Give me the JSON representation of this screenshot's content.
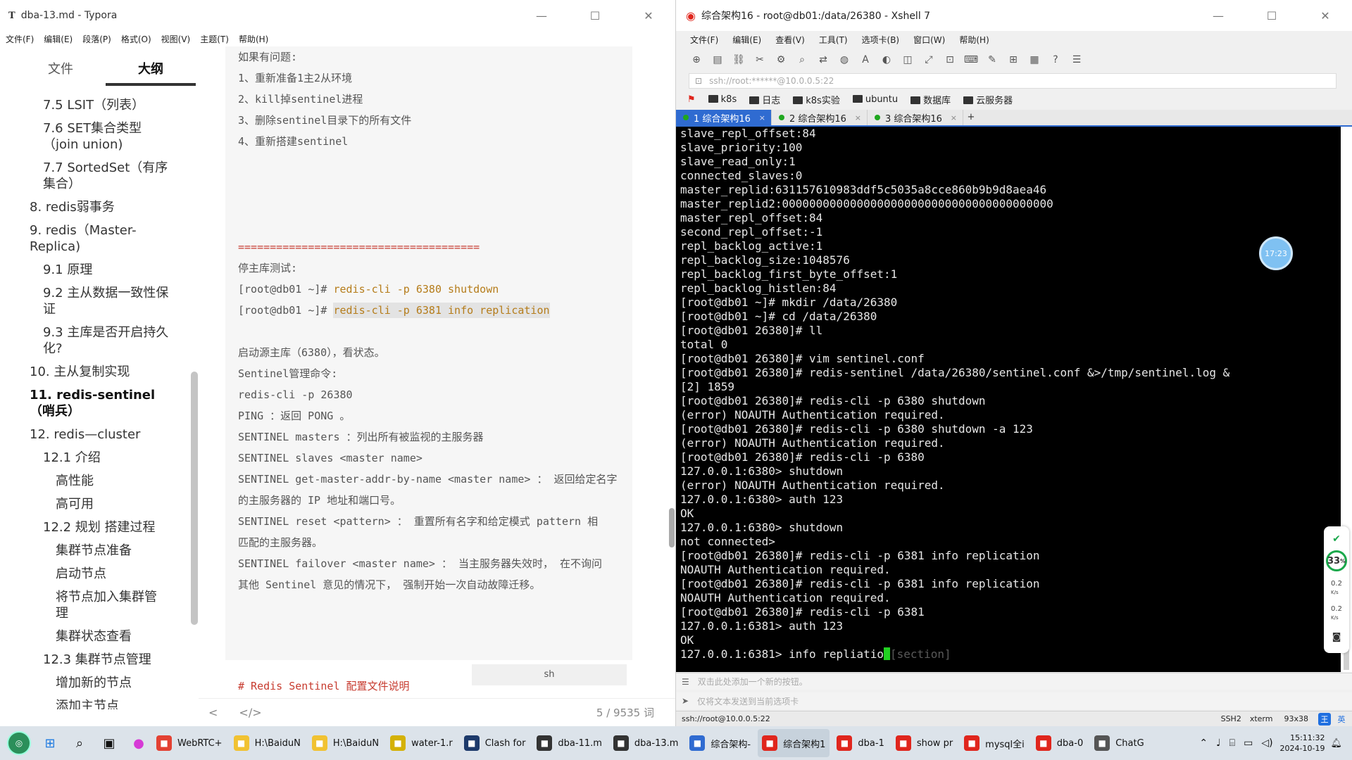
{
  "typora": {
    "title": "dba-13.md - Typora",
    "title_icon": "T",
    "controls": {
      "minimize": "—",
      "maximize": "☐",
      "close": "✕"
    },
    "menu": [
      "文件(F)",
      "编辑(E)",
      "段落(P)",
      "格式(O)",
      "视图(V)",
      "主题(T)",
      "帮助(H)"
    ],
    "sidebar_tabs": [
      "文件",
      "大纲"
    ],
    "active_tab": "大纲",
    "outline": [
      {
        "text": "7.5 LSIT（列表）",
        "level": 2
      },
      {
        "text": "7.6 SET集合类型（join union)",
        "level": 2
      },
      {
        "text": "7.7 SortedSet（有序集合）",
        "level": 2
      },
      {
        "text": "8. redis弱事务",
        "level": 1
      },
      {
        "text": "9. redis（Master-Replica)",
        "level": 1
      },
      {
        "text": "9.1 原理",
        "level": 2
      },
      {
        "text": "9.2 主从数据一致性保证",
        "level": 2
      },
      {
        "text": "9.3 主库是否开启持久化?",
        "level": 2
      },
      {
        "text": "10. 主从复制实现",
        "level": 1
      },
      {
        "text": "11. redis-sentinel（哨兵）",
        "level": 1,
        "bold": true
      },
      {
        "text": "12. redis—cluster",
        "level": 1
      },
      {
        "text": "12.1 介绍",
        "level": 2
      },
      {
        "text": "高性能",
        "level": 3
      },
      {
        "text": "高可用",
        "level": 3
      },
      {
        "text": "12.2 规划 搭建过程",
        "level": 2
      },
      {
        "text": "集群节点准备",
        "level": 3
      },
      {
        "text": "启动节点",
        "level": 3
      },
      {
        "text": "将节点加入集群管理",
        "level": 3
      },
      {
        "text": "集群状态查看",
        "level": 3
      },
      {
        "text": "12.3 集群节点管理",
        "level": 2
      },
      {
        "text": "增加新的节点",
        "level": 3
      },
      {
        "text": "添加主节点",
        "level": 3
      }
    ],
    "code_lines": [
      {
        "text": "如果有问题:"
      },
      {
        "text": "1、重新准备1主2从环境"
      },
      {
        "text": "2、kill掉sentinel进程"
      },
      {
        "text": "3、删除sentinel目录下的所有文件"
      },
      {
        "text": "4、重新搭建sentinel"
      },
      {
        "text": ""
      },
      {
        "text": ""
      },
      {
        "text": ""
      },
      {
        "text": ""
      },
      {
        "text": "======================================",
        "style": "sep"
      },
      {
        "text": "停主库测试:"
      },
      {
        "text": "[root@db01 ~]# ",
        "cmd": "redis-cli -p 6380 shutdown"
      },
      {
        "text": "[root@db01 ~]# ",
        "cmd": "redis-cli -p 6381 info replication",
        "highlight": true
      },
      {
        "text": ""
      },
      {
        "text": "启动源主库（6380），看状态。"
      },
      {
        "text": "Sentinel管理命令:"
      },
      {
        "text": "redis-cli -p 26380"
      },
      {
        "text": "PING ：返回 PONG 。"
      },
      {
        "text": "SENTINEL masters ：列出所有被监视的主服务器"
      },
      {
        "text": "SENTINEL slaves <master name>"
      },
      {
        "text": "SENTINEL get-master-addr-by-name <master name> ： 返回给定名字"
      },
      {
        "text": "的主服务器的 IP 地址和端口号。"
      },
      {
        "text": "SENTINEL reset <pattern> ： 重置所有名字和给定模式 pattern 相"
      },
      {
        "text": "匹配的主服务器。"
      },
      {
        "text": "SENTINEL failover <master name> ： 当主服务器失效时， 在不询问"
      },
      {
        "text": "其他 Sentinel 意见的情况下， 强制开始一次自动故障迁移。"
      }
    ],
    "code_lang": "sh",
    "next_heading": "# Redis Sentinel 配置文件说明",
    "status_left": "<",
    "status_code_toggle": "</>",
    "word_count": "5 / 9535 词"
  },
  "xshell": {
    "title": "综合架构16 - root@db01:/data/26380 - Xshell 7",
    "controls": {
      "minimize": "—",
      "maximize": "☐",
      "close": "✕"
    },
    "menu": [
      "文件(F)",
      "编辑(E)",
      "查看(V)",
      "工具(T)",
      "选项卡(B)",
      "窗口(W)",
      "帮助(H)"
    ],
    "address": "ssh://root:******@10.0.0.5:22",
    "bookmarks": [
      "k8s",
      "日志",
      "k8s实验",
      "ubuntu",
      "数据库",
      "云服务器"
    ],
    "tabs": [
      {
        "label": "1 综合架构16",
        "active": true
      },
      {
        "label": "2 综合架构16",
        "active": false
      },
      {
        "label": "3 综合架构16",
        "active": false
      }
    ],
    "terminal_lines": [
      "slave_repl_offset:84",
      "slave_priority:100",
      "slave_read_only:1",
      "connected_slaves:0",
      "master_replid:631157610983ddf5c5035a8cce860b9b9d8aea46",
      "master_replid2:0000000000000000000000000000000000000000",
      "master_repl_offset:84",
      "second_repl_offset:-1",
      "repl_backlog_active:1",
      "repl_backlog_size:1048576",
      "repl_backlog_first_byte_offset:1",
      "repl_backlog_histlen:84",
      "[root@db01 ~]# mkdir /data/26380",
      "[root@db01 ~]# cd /data/26380",
      "[root@db01 26380]# ll",
      "total 0",
      "[root@db01 26380]# vim sentinel.conf",
      "[root@db01 26380]# redis-sentinel /data/26380/sentinel.conf &>/tmp/sentinel.log &",
      "[2] 1859",
      "[root@db01 26380]# redis-cli -p 6380 shutdown",
      "(error) NOAUTH Authentication required.",
      "[root@db01 26380]# redis-cli -p 6380 shutdown -a 123",
      "(error) NOAUTH Authentication required.",
      "[root@db01 26380]# redis-cli -p 6380",
      "127.0.0.1:6380> shutdown",
      "(error) NOAUTH Authentication required.",
      "127.0.0.1:6380> auth 123",
      "OK",
      "127.0.0.1:6380> shutdown",
      "not connected>",
      "[root@db01 26380]# redis-cli -p 6381 info replication",
      "NOAUTH Authentication required.",
      "[root@db01 26380]# redis-cli -p 6381 info replication",
      "NOAUTH Authentication required.",
      "[root@db01 26380]# redis-cli -p 6381",
      "127.0.0.1:6381> auth 123",
      "OK"
    ],
    "prompt_line": "127.0.0.1:6381> info repliatio",
    "prompt_hint": "[section]",
    "input_placeholder": "双击此处添加一个新的按钮。",
    "send_placeholder": "仅将文本发送到当前选项卡",
    "status_host": "ssh://root@10.0.0.5:22",
    "status_proto": "SSH2",
    "status_term": "xterm",
    "status_size": "93x38",
    "ime": [
      "王",
      "英"
    ]
  },
  "floating": {
    "bubble": "17:23",
    "cpu": "33",
    "cpu_unit": "%",
    "up": "0.2",
    "down": "0.2",
    "speed_unit": "K/s"
  },
  "taskbar": {
    "apps": [
      {
        "label": "WebRTC+",
        "color": "#e34133"
      },
      {
        "label": "H:\\BaiduN",
        "color": "#f1c232"
      },
      {
        "label": "H:\\BaiduN",
        "color": "#f1c232"
      },
      {
        "label": "water-1.r",
        "color": "#d4b106"
      },
      {
        "label": "Clash for",
        "color": "#1d3a6b"
      },
      {
        "label": "dba-11.m",
        "color": "#333333"
      },
      {
        "label": "dba-13.m",
        "color": "#333333"
      },
      {
        "label": "综合架构-",
        "color": "#2f6bd1"
      },
      {
        "label": "综合架构1",
        "color": "#e0261d",
        "active": true
      },
      {
        "label": "dba-1",
        "color": "#e0261d"
      },
      {
        "label": "show pr",
        "color": "#e0261d"
      },
      {
        "label": "mysql全i",
        "color": "#e0261d"
      },
      {
        "label": "dba-0",
        "color": "#e0261d"
      },
      {
        "label": "ChatG",
        "color": "#555555"
      }
    ],
    "time": "15:11:32",
    "date": "2024-10-19"
  }
}
